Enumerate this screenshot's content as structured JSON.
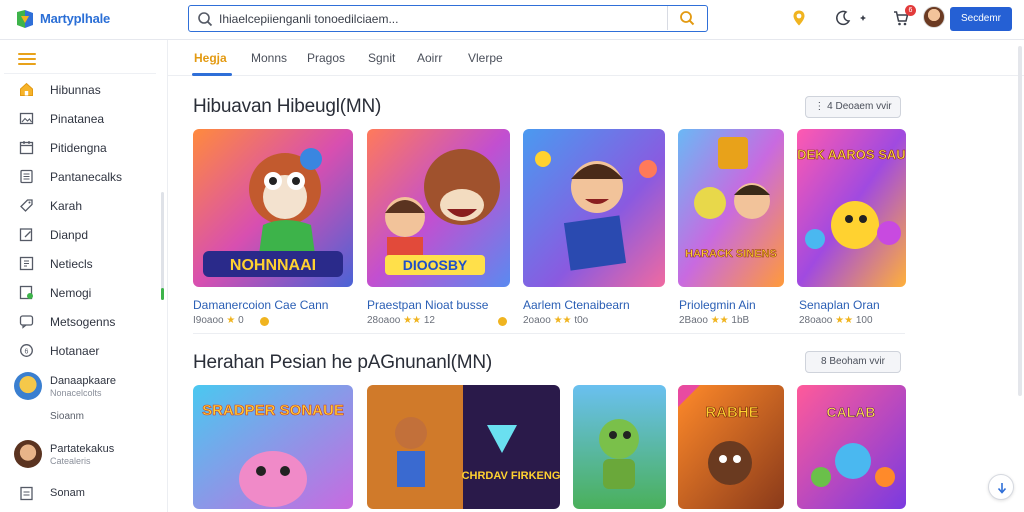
{
  "app": {
    "brand": "Martyplhale",
    "accent": "#2f6fd8",
    "brand_orange": "#e39a12"
  },
  "header": {
    "search_value": "Ihiaelcepiienganli tonoedilciaem...",
    "notification_count": "6",
    "primary_button": "Secdemr",
    "icons": [
      "location-pin-icon",
      "moon-icon",
      "cart-icon",
      "avatar"
    ]
  },
  "sidebar": {
    "items": [
      {
        "label": "Hibunnas",
        "icon": "home-icon"
      },
      {
        "label": "Pinatanea",
        "icon": "image-icon"
      },
      {
        "label": "Pitidengna",
        "icon": "calendar-icon"
      },
      {
        "label": "Pantanecalks",
        "icon": "list-icon"
      },
      {
        "label": "Karah",
        "icon": "tag-icon"
      },
      {
        "label": "Dianpd",
        "icon": "edit-icon"
      },
      {
        "label": "Netiecls",
        "icon": "grid-icon"
      },
      {
        "label": "Nemogi",
        "icon": "leaf-icon"
      },
      {
        "label": "Metsogenns",
        "icon": "message-icon"
      },
      {
        "label": "Hotanaer",
        "icon": "circle-icon"
      }
    ],
    "channels": [
      {
        "name": "Danaapkaare",
        "sub": "Nonacelcolts"
      },
      {
        "name": "Partatekakus",
        "sub": "Catealeris"
      }
    ],
    "side_small_1": "Sioanm",
    "footer_label": "Sonam"
  },
  "tabs": [
    {
      "label": "Hegja",
      "active": true
    },
    {
      "label": "Monns",
      "active": false
    },
    {
      "label": "Pragos",
      "active": false
    },
    {
      "label": "Sgnit",
      "active": false
    },
    {
      "label": "Aoirr",
      "active": false
    },
    {
      "label": "Vlerpe",
      "active": false
    }
  ],
  "section1": {
    "title": "Hibuavan Hibeugl(MN)",
    "pill": "⋮ 4 Deoaem vvir",
    "cards": [
      {
        "title": "Damanercoion Cae Cann",
        "meta_prefix": "I9oaoo",
        "stars": "★",
        "meta_suffix": "0"
      },
      {
        "title": "Praestpan Nioat busse",
        "meta_prefix": "28oaoo",
        "stars": "★★",
        "meta_suffix": "12"
      },
      {
        "title": "Aarlem Ctenaibearn",
        "meta_prefix": "2oaoo",
        "stars": "★★",
        "meta_suffix": "t0o"
      },
      {
        "title": "Priolegmin Ain",
        "meta_prefix": "2Baoo",
        "stars": "★★",
        "meta_suffix": "1bB"
      },
      {
        "title": "Senaplan Oran",
        "meta_prefix": "28oaoo",
        "stars": "★★",
        "meta_suffix": "100"
      }
    ],
    "card_texts": [
      "NOHNNAAI",
      "DIOOSBY",
      "",
      "HARACK SINENS",
      "SODEK AAROS SAUNS"
    ]
  },
  "section2": {
    "title": "Herahan Pesian he pAGnunanl(MN)",
    "pill": "8 Beoham vvir",
    "card_texts": [
      "SRADPER SONAUE",
      "CHRDAV FIRKENG",
      "",
      "RABHE",
      "CALAB"
    ]
  }
}
